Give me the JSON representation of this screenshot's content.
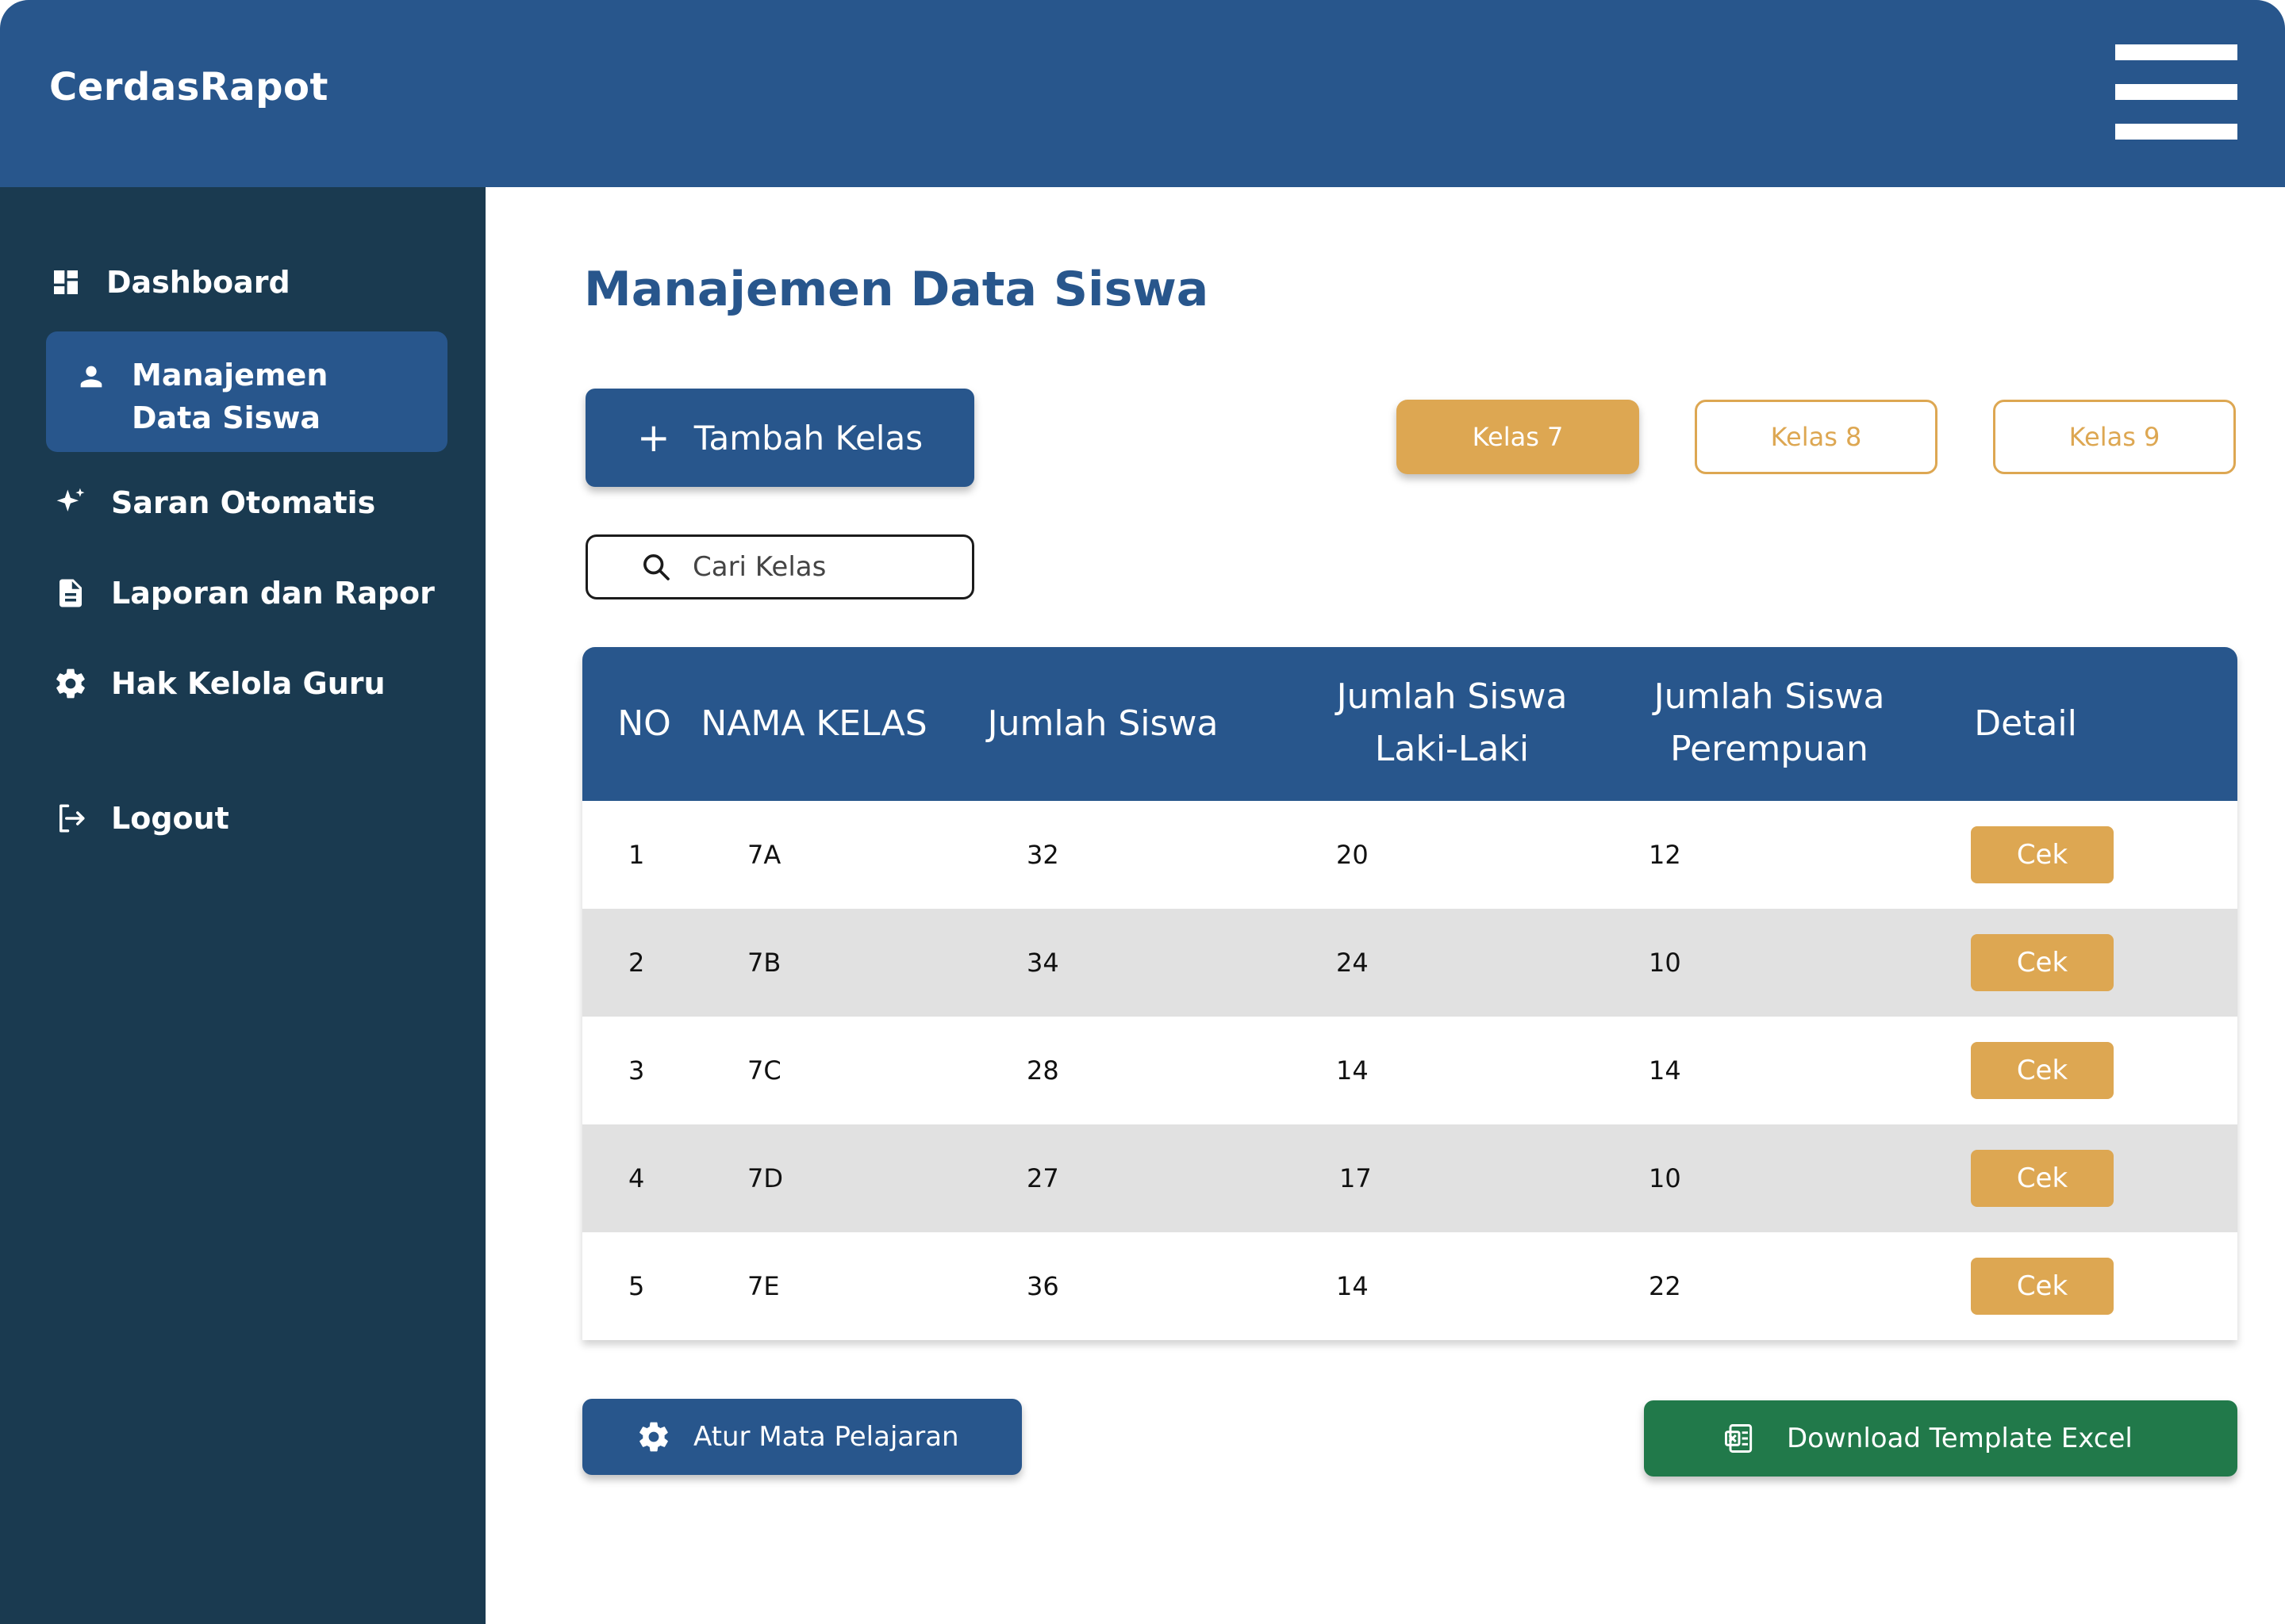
{
  "app": {
    "title": "CerdasRapot",
    "menu_icon": "hamburger-icon"
  },
  "sidebar": {
    "items": [
      {
        "label": "Dashboard",
        "icon": "dashboard-icon"
      },
      {
        "label": "Manajemen Data Siswa",
        "icon": "user-icon",
        "active": true
      },
      {
        "label": "Saran Otomatis",
        "icon": "sparkle-icon"
      },
      {
        "label": "Laporan dan Rapor",
        "icon": "document-icon"
      },
      {
        "label": "Hak Kelola Guru",
        "icon": "gear-icon"
      },
      {
        "label": "Logout",
        "icon": "logout-icon"
      }
    ]
  },
  "main": {
    "title": "Manajemen Data Siswa",
    "add_button": "Tambah Kelas",
    "tabs": [
      {
        "label": "Kelas 7",
        "selected": true
      },
      {
        "label": "Kelas 8",
        "selected": false
      },
      {
        "label": "Kelas 9",
        "selected": false
      }
    ],
    "search": {
      "placeholder": "Cari Kelas",
      "value": ""
    },
    "table": {
      "headers": [
        "NO",
        "NAMA KELAS",
        "Jumlah Siswa",
        "Jumlah Siswa Laki-Laki",
        "Jumlah Siswa Perempuan",
        "Detail"
      ],
      "rows": [
        {
          "no": "1",
          "kelas": "7A",
          "jumlah": "32",
          "laki": "20",
          "perempuan": "12",
          "detail": "Cek"
        },
        {
          "no": "2",
          "kelas": "7B",
          "jumlah": "34",
          "laki": "24",
          "perempuan": "10",
          "detail": "Cek"
        },
        {
          "no": "3",
          "kelas": "7C",
          "jumlah": "28",
          "laki": "14",
          "perempuan": "14",
          "detail": "Cek"
        },
        {
          "no": "4",
          "kelas": "7D",
          "jumlah": "27",
          "laki": "17",
          "perempuan": "10",
          "detail": "Cek"
        },
        {
          "no": "5",
          "kelas": "7E",
          "jumlah": "36",
          "laki": "14",
          "perempuan": "22",
          "detail": "Cek"
        }
      ]
    },
    "atur_button": "Atur Mata Pelajaran",
    "download_button": "Download Template Excel"
  },
  "colors": {
    "primary": "#28568c",
    "sidebar": "#1a3a50",
    "accent": "#dda752",
    "success": "#21794a",
    "row_alt": "#e1e1e1"
  }
}
